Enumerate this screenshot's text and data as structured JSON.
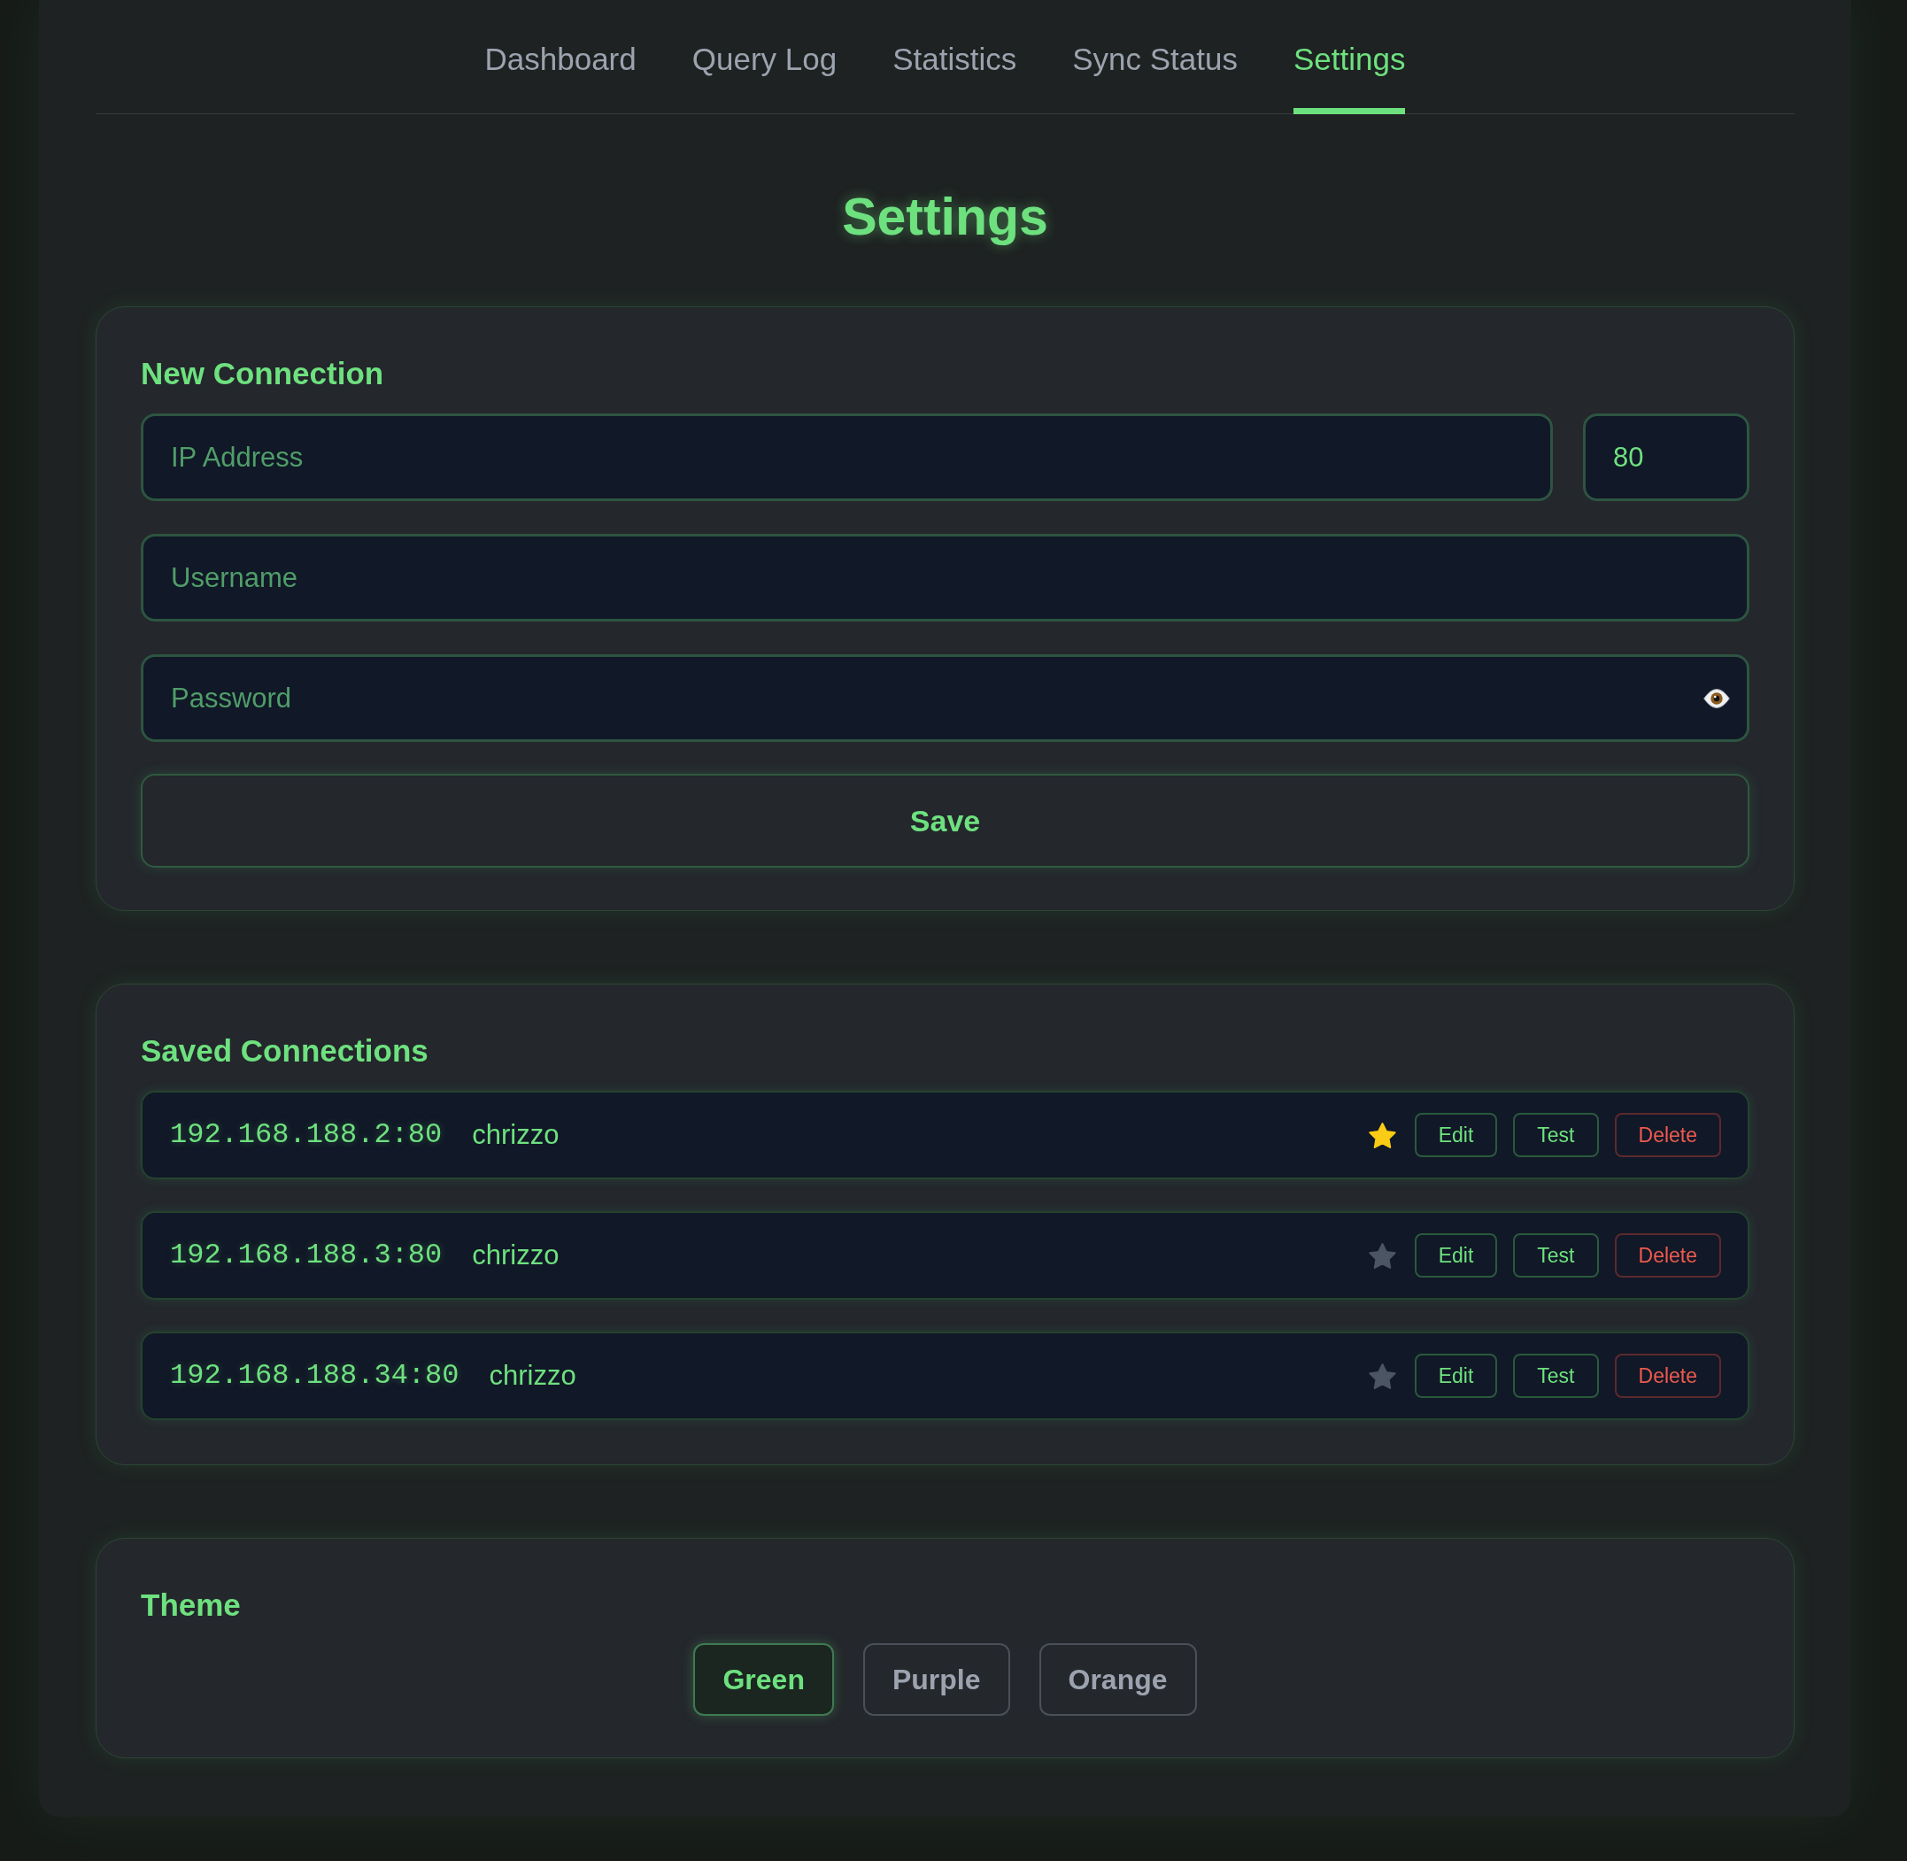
{
  "nav": {
    "tabs": [
      {
        "label": "Dashboard",
        "selected": false
      },
      {
        "label": "Query Log",
        "selected": false
      },
      {
        "label": "Statistics",
        "selected": false
      },
      {
        "label": "Sync Status",
        "selected": false
      },
      {
        "label": "Settings",
        "selected": true
      }
    ]
  },
  "page_title": "Settings",
  "new_connection": {
    "heading": "New Connection",
    "ip_field": {
      "placeholder": "IP Address"
    },
    "port_field": {
      "value": "80"
    },
    "username_field": {
      "placeholder": "Username"
    },
    "password_field": {
      "placeholder": "Password"
    },
    "save_button": "Save"
  },
  "saved_connections": {
    "heading": "Saved Connections",
    "items": [
      {
        "address": "192.168.188.2:80",
        "username": "chrizzo",
        "favorite": true,
        "actions": [
          {
            "label": "Edit",
            "kind": "default"
          },
          {
            "label": "Test",
            "kind": "default"
          },
          {
            "label": "Delete",
            "kind": "danger"
          }
        ]
      },
      {
        "address": "192.168.188.3:80",
        "username": "chrizzo",
        "favorite": false,
        "actions": [
          {
            "label": "Edit",
            "kind": "default"
          },
          {
            "label": "Test",
            "kind": "default"
          },
          {
            "label": "Delete",
            "kind": "danger"
          }
        ]
      },
      {
        "address": "192.168.188.34:80",
        "username": "chrizzo",
        "favorite": false,
        "actions": [
          {
            "label": "Edit",
            "kind": "default"
          },
          {
            "label": "Test",
            "kind": "default"
          },
          {
            "label": "Delete",
            "kind": "danger"
          }
        ]
      }
    ]
  },
  "theme": {
    "heading": "Theme",
    "options": [
      {
        "label": "Green",
        "selected": true
      },
      {
        "label": "Purple",
        "selected": false
      },
      {
        "label": "Orange",
        "selected": false
      }
    ]
  }
}
